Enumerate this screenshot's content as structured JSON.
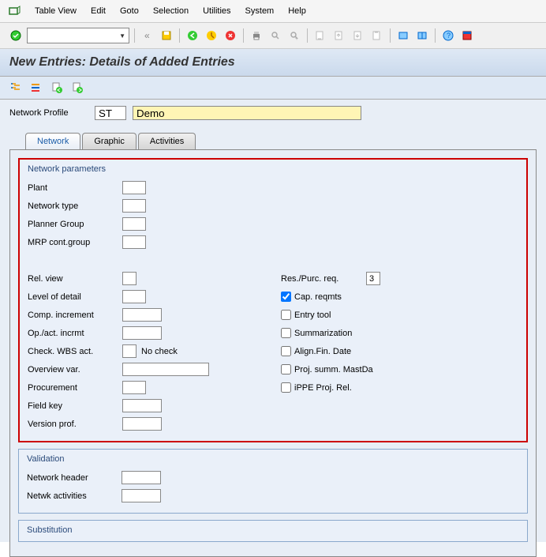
{
  "menu": {
    "table_view": "Table View",
    "edit": "Edit",
    "goto": "Goto",
    "selection": "Selection",
    "utilities": "Utilities",
    "system": "System",
    "help": "Help"
  },
  "title": "New Entries: Details of Added Entries",
  "profile": {
    "label": "Network Profile",
    "code": "ST",
    "desc": "Demo"
  },
  "tabs": {
    "network": "Network",
    "graphic": "Graphic",
    "activities": "Activities"
  },
  "net_params": {
    "title": "Network parameters",
    "plant": "Plant",
    "network_type": "Network type",
    "planner_group": "Planner Group",
    "mrp_group": "MRP cont.group",
    "rel_view": "Rel. view",
    "level_detail": "Level of detail",
    "comp_incr": "Comp. increment",
    "op_incr": "Op./act. incrmt",
    "check_wbs": "Check. WBS act.",
    "check_wbs_text": "No check",
    "overview_var": "Overview var.",
    "procurement": "Procurement",
    "field_key": "Field key",
    "version_prof": "Version prof.",
    "res_purc": "Res./Purc. req.",
    "res_purc_val": "3",
    "cap_reqmts": "Cap. reqmts",
    "entry_tool": "Entry tool",
    "summarization": "Summarization",
    "align_fin": "Align.Fin. Date",
    "proj_summ": "Proj. summ. MastDa",
    "ippe": "iPPE Proj. Rel."
  },
  "validation": {
    "title": "Validation",
    "net_header": "Network header",
    "net_activities": "Netwk activities"
  },
  "substitution": {
    "title": "Substitution"
  }
}
